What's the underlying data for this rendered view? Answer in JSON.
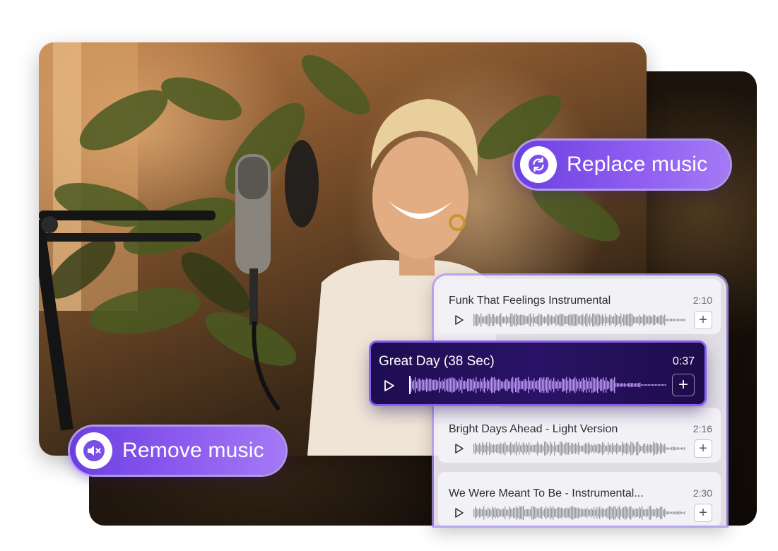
{
  "buttons": {
    "replace_label": "Replace music",
    "remove_label": "Remove music"
  },
  "tracks": [
    {
      "title": "Funk That Feelings Instrumental",
      "duration": "2:10"
    },
    {
      "title": "Great Day (38 Sec)",
      "duration": "0:37",
      "selected": true
    },
    {
      "title": "Bright Days Ahead - Light Version",
      "duration": "2:16"
    },
    {
      "title": "We Were Meant To Be - Instrumental...",
      "duration": "2:30"
    }
  ],
  "add_symbol": "+",
  "colors": {
    "accent": "#7c4cf0",
    "active_track_bg": "#22105a",
    "panel_bg": "#f0eef5"
  },
  "icons": [
    "refresh-icon",
    "mute-icon",
    "play-icon",
    "plus-icon",
    "waveform"
  ]
}
